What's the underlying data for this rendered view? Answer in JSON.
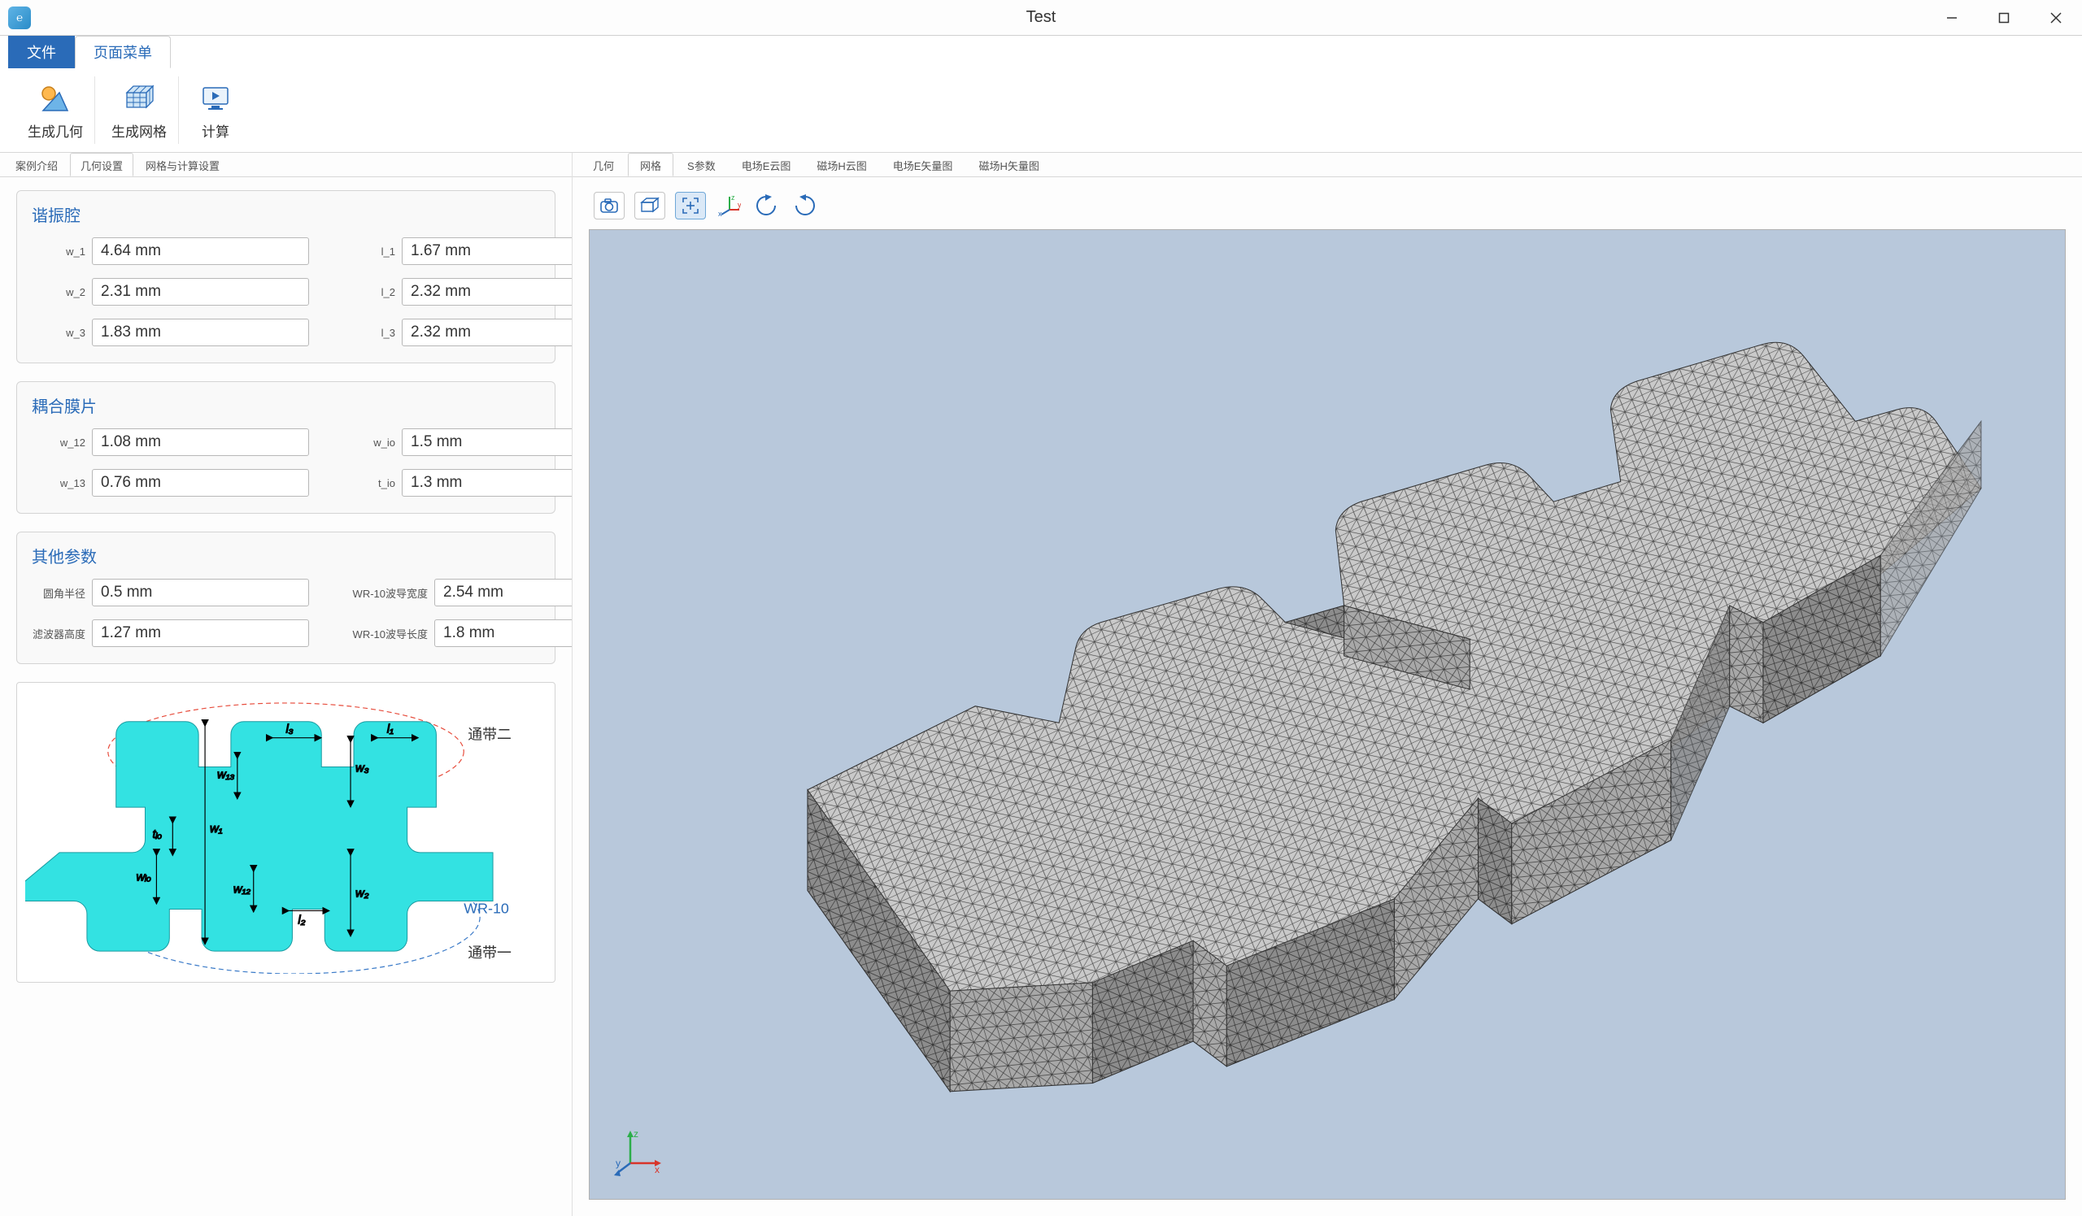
{
  "window": {
    "title": "Test",
    "app_icon_glyph": "℮"
  },
  "ribbon": {
    "tabs": {
      "file": "文件",
      "page_menu": "页面菜单"
    },
    "buttons": {
      "gen_geometry": "生成几何",
      "gen_mesh": "生成网格",
      "compute": "计算"
    }
  },
  "left_panel": {
    "tabs": {
      "case_intro": "案例介绍",
      "geom_settings": "几何设置",
      "mesh_compute": "网格与计算设置"
    },
    "sections": {
      "resonant_cavity": {
        "title": "谐振腔",
        "fields": {
          "w_1": {
            "label": "w_1",
            "value": "4.64 mm"
          },
          "l_1": {
            "label": "l_1",
            "value": "1.67 mm"
          },
          "w_2": {
            "label": "w_2",
            "value": "2.31 mm"
          },
          "l_2": {
            "label": "l_2",
            "value": "2.32 mm"
          },
          "w_3": {
            "label": "w_3",
            "value": "1.83 mm"
          },
          "l_3": {
            "label": "l_3",
            "value": "2.32 mm"
          }
        }
      },
      "coupling_iris": {
        "title": "耦合膜片",
        "fields": {
          "w_12": {
            "label": "w_12",
            "value": "1.08 mm"
          },
          "w_io": {
            "label": "w_io",
            "value": "1.5 mm"
          },
          "w_13": {
            "label": "w_13",
            "value": "0.76 mm"
          },
          "t_io": {
            "label": "t_io",
            "value": "1.3 mm"
          }
        }
      },
      "other_params": {
        "title": "其他参数",
        "fields": {
          "fillet_radius": {
            "label": "圆角半径",
            "value": "0.5 mm"
          },
          "wr10_width": {
            "label": "WR-10波导宽度",
            "value": "2.54 mm"
          },
          "filter_height": {
            "label": "滤波器高度",
            "value": "1.27 mm"
          },
          "wr10_length": {
            "label": "WR-10波导长度",
            "value": "1.8 mm"
          }
        }
      }
    },
    "diagram": {
      "passband1": "通带一",
      "passband2": "通带二",
      "wr_label": "WR-10",
      "dim_labels": [
        "l₁",
        "l₂",
        "l₃",
        "w₁",
        "w₂",
        "w₃",
        "w₁₂",
        "w₁₃",
        "wᵢₒ",
        "tᵢₒ"
      ]
    }
  },
  "right_panel": {
    "tabs": {
      "geometry": "几何",
      "mesh": "网格",
      "s_params": "S参数",
      "e_cloud": "电场E云图",
      "h_cloud": "磁场H云图",
      "e_vector": "电场E矢量图",
      "h_vector": "磁场H矢量图"
    },
    "tools": {
      "camera": "camera-icon",
      "box": "bounding-box-icon",
      "fit": "fit-view-icon",
      "axes": "axes-icon",
      "rot_ccw": "rotate-ccw-icon",
      "rot_cw": "rotate-cw-icon"
    },
    "axis_labels": {
      "x": "x",
      "y": "y",
      "z": "z"
    }
  }
}
